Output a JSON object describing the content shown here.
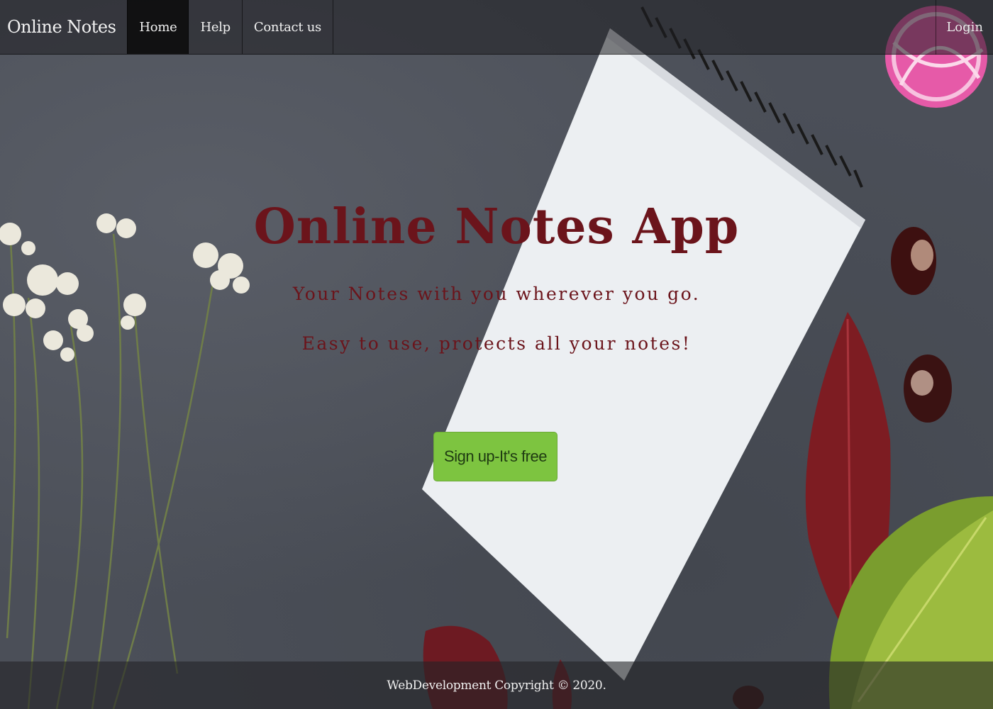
{
  "navbar": {
    "brand": "Online Notes",
    "items": [
      {
        "label": "Home",
        "active": true
      },
      {
        "label": "Help",
        "active": false
      },
      {
        "label": "Contact us",
        "active": false
      }
    ],
    "login_label": "Login"
  },
  "hero": {
    "title": "Online Notes App",
    "subtitle_1": "Your Notes with you wherever you go.",
    "subtitle_2": "Easy to use, protects all your notes!",
    "signup_label": "Sign up-It's free"
  },
  "footer": {
    "copyright": "WebDevelopment Copyright © 2020."
  },
  "colors": {
    "title": "#6b141b",
    "signup_button": "#7dc440",
    "background": "#4b4f58"
  }
}
